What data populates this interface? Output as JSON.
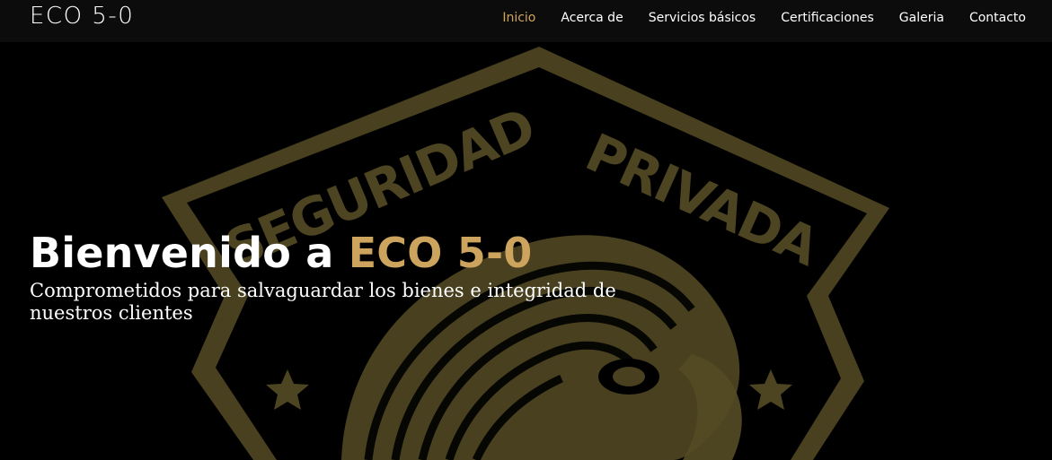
{
  "header": {
    "logo": "ECO 5-0",
    "nav": [
      {
        "label": "Inicio",
        "active": true
      },
      {
        "label": "Acerca de",
        "active": false
      },
      {
        "label": "Servicios básicos",
        "active": false
      },
      {
        "label": "Certificaciones",
        "active": false
      },
      {
        "label": "Galeria",
        "active": false
      },
      {
        "label": "Contacto",
        "active": false
      }
    ]
  },
  "hero": {
    "title_prefix": "Bienvenido a",
    "title_brand": "ECO 5-0",
    "subtitle": "Comprometidos para salvaguardar los bienes e integridad de nuestros clientes",
    "background_emblem": {
      "icon": "security-badge-eagle-emblem",
      "text_left": "SEGURIDAD",
      "text_right": "PRIVADA"
    }
  },
  "colors": {
    "accent": "#cda45e",
    "emblem_gold": "#8a7a3c",
    "header_bg": "#0d0d0d",
    "page_bg": "#000000",
    "text": "#ffffff"
  }
}
